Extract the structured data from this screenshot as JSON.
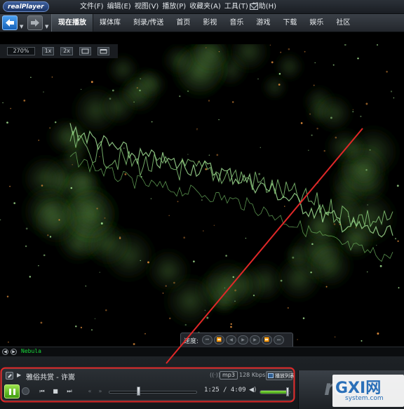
{
  "app": {
    "logo": "realPlayer"
  },
  "menubar": {
    "items": [
      "文件(F)",
      "编辑(E)",
      "视图(V)",
      "播放(P)",
      "收藏夹(A)",
      "工具(T)",
      "帮助(H)"
    ]
  },
  "nav": {
    "tabs": [
      {
        "label": "现在播放",
        "active": true
      },
      {
        "label": "媒体库",
        "active": false
      },
      {
        "label": "刻录/传送",
        "active": false
      },
      {
        "label": "首页",
        "active": false
      },
      {
        "label": "影视",
        "active": false
      },
      {
        "label": "音乐",
        "active": false
      },
      {
        "label": "游戏",
        "active": false
      },
      {
        "label": "下载",
        "active": false
      },
      {
        "label": "娱乐",
        "active": false
      },
      {
        "label": "社区",
        "active": false
      }
    ]
  },
  "view": {
    "zoom": "270%",
    "btn_1x": "1x",
    "btn_2x": "2x"
  },
  "speed": {
    "label": "速度:",
    "buttons": [
      "⏮",
      "⏪",
      "◀",
      "▶",
      "▶",
      "⏩",
      "⏭"
    ]
  },
  "visualization": {
    "name": "Nebula"
  },
  "player": {
    "track_title": "雅俗共赏 - 许嵩",
    "format": "mp3",
    "bitrate": "128 Kbps",
    "playlist_label": "播放列表",
    "current_time": "1:25",
    "total_time": "4:09",
    "time_display": "1:25 / 4:09",
    "progress": 0.341,
    "volume": 0.92
  },
  "brand": {
    "text": "re"
  },
  "watermark": {
    "main": "GXI网",
    "sub": "system.com"
  },
  "colors": {
    "accent_play": "#5cc21f",
    "annotation_red": "#e02828",
    "viz_green": "#8fe38a"
  }
}
